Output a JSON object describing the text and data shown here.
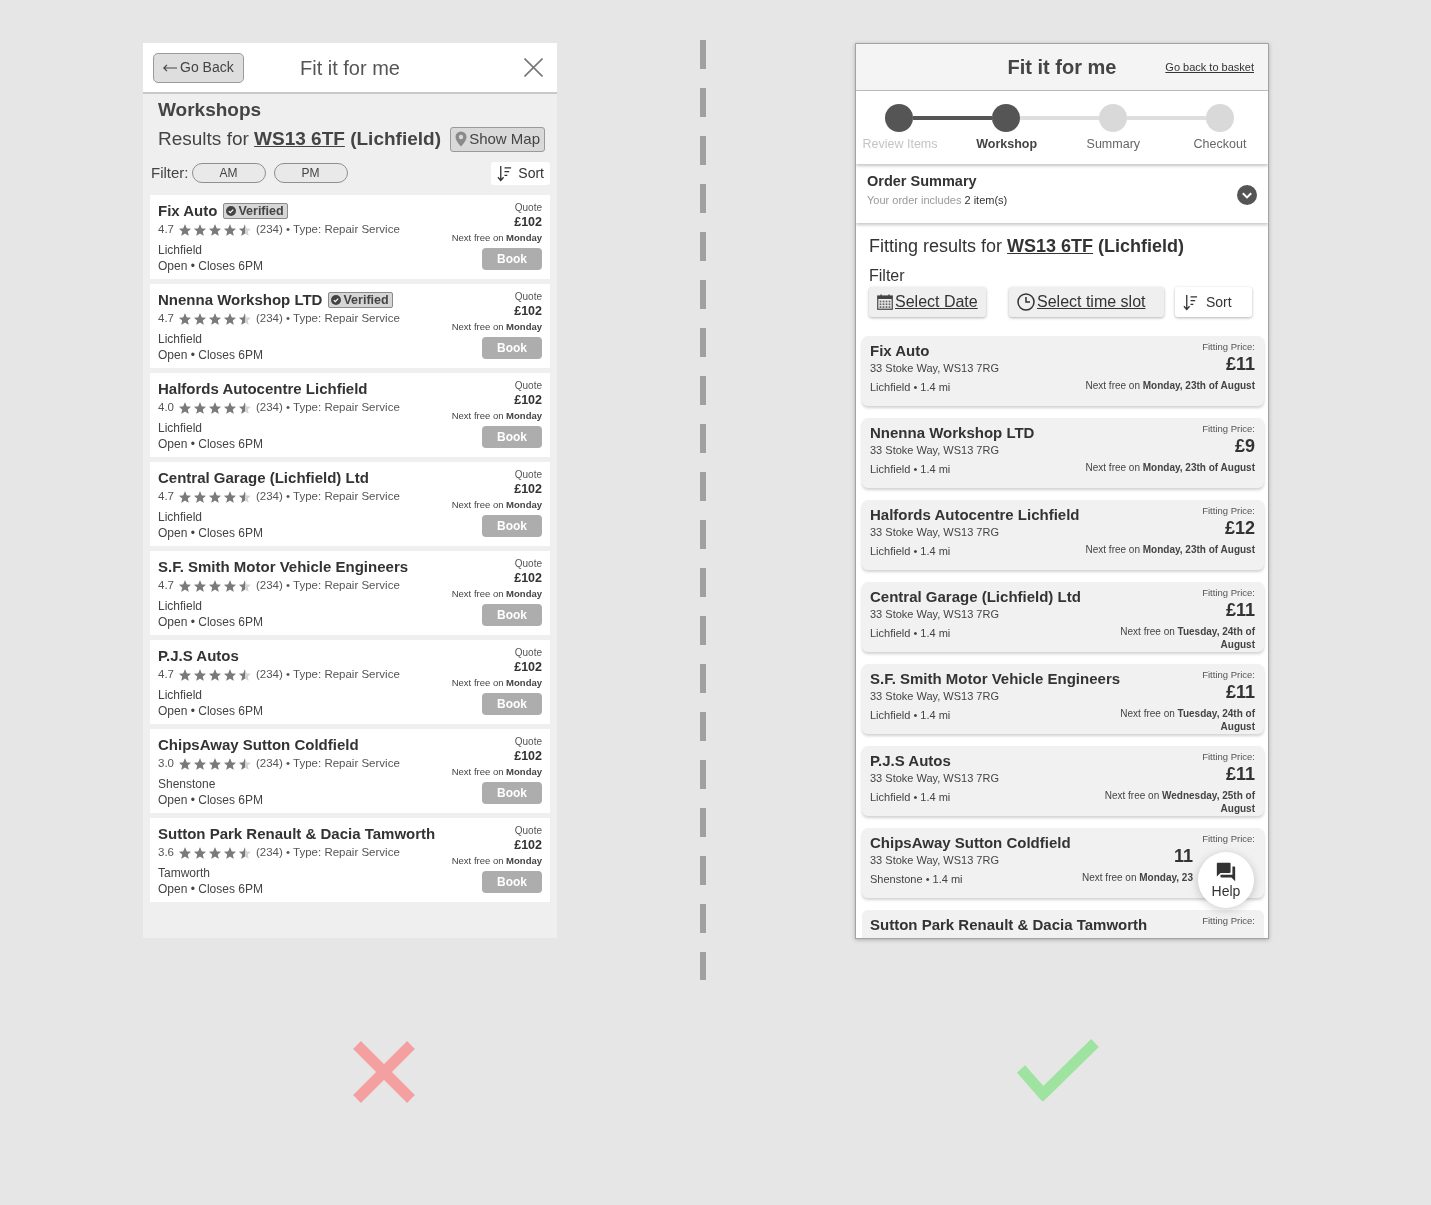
{
  "wrong_mockup": {
    "correct": false,
    "header": {
      "back_button": "Go Back",
      "title": "Fit it for me"
    },
    "heading": "Workshops",
    "results": {
      "prefix": "Results for",
      "postcode": "WS13 6TF",
      "area": "(Lichfield)"
    },
    "show_map_button": "Show Map",
    "filter": {
      "label": "Filter:",
      "options": [
        {
          "label": "AM",
          "selected": false
        },
        {
          "label": "PM",
          "selected": false
        }
      ]
    },
    "sort_button": "Sort",
    "workshops": [
      {
        "name": "Fix Auto",
        "badge": "Verified",
        "rating": "4.7",
        "stars": 4.5,
        "reviews": "(234) • Type: Repair Service",
        "town": "Lichfield",
        "hours": "Open • Closes 6PM",
        "quote_label": "Quote",
        "quote": "£102",
        "next_free": "Next free on **Monday**",
        "book_button": "Book"
      },
      {
        "name": "Nnenna Workshop LTD",
        "badge": "Verified",
        "rating": "4.7",
        "stars": 4.5,
        "reviews": "(234) • Type: Repair Service",
        "town": "Lichfield",
        "hours": "Open • Closes 6PM",
        "quote_label": "Quote",
        "quote": "£102",
        "next_free": "Next free on **Monday**",
        "book_button": "Book"
      },
      {
        "name": "Halfords Autocentre Lichfield",
        "rating": "4.0",
        "stars": 4.5,
        "reviews": "(234) • Type: Repair Service",
        "town": "Lichfield",
        "hours": "Open • Closes 6PM",
        "quote_label": "Quote",
        "quote": "£102",
        "next_free": "Next free on **Monday**",
        "book_button": "Book"
      },
      {
        "name": "Central Garage (Lichfield) Ltd",
        "rating": "4.7",
        "stars": 4.5,
        "reviews": "(234) • Type: Repair Service",
        "town": "Lichfield",
        "hours": "Open • Closes 6PM",
        "quote_label": "Quote",
        "quote": "£102",
        "next_free": "Next free on **Monday**",
        "book_button": "Book"
      },
      {
        "name": "S.F. Smith Motor Vehicle Engineers",
        "rating": "4.7",
        "stars": 4.5,
        "reviews": "(234) • Type: Repair Service",
        "town": "Lichfield",
        "hours": "Open • Closes 6PM",
        "quote_label": "Quote",
        "quote": "£102",
        "next_free": "Next free on **Monday**",
        "book_button": "Book"
      },
      {
        "name": "P.J.S Autos",
        "rating": "4.7",
        "stars": 4.5,
        "reviews": "(234) • Type: Repair Service",
        "town": "Lichfield",
        "hours": "Open • Closes 6PM",
        "quote_label": "Quote",
        "quote": "£102",
        "next_free": "Next free on **Monday**",
        "book_button": "Book"
      },
      {
        "name": "ChipsAway Sutton Coldfield",
        "rating": "3.0",
        "stars": 4.5,
        "reviews": "(234) • Type: Repair Service",
        "town": "Shenstone",
        "hours": "Open • Closes 6PM",
        "quote_label": "Quote",
        "quote": "£102",
        "next_free": "Next free on **Monday**",
        "book_button": "Book"
      },
      {
        "name": "Sutton Park Renault & Dacia Tamworth",
        "rating": "3.6",
        "stars": 4.5,
        "reviews": "(234) • Type: Repair Service",
        "town": "Tamworth",
        "hours": "Open • Closes 6PM",
        "quote_label": "Quote",
        "quote": "£102",
        "next_free": "Next free on **Monday**",
        "book_button": "Book"
      }
    ]
  },
  "right_mockup": {
    "correct": true,
    "header": {
      "title": "Fit it for me",
      "back_link": "Go back to basket"
    },
    "steps": [
      {
        "label": "Review Items",
        "reached": true,
        "selected": false
      },
      {
        "label": "Workshop",
        "reached": true,
        "selected": true
      },
      {
        "label": "Summary",
        "reached": false,
        "selected": false
      },
      {
        "label": "Checkout",
        "reached": false,
        "selected": false
      }
    ],
    "order_summary": {
      "title": "Order Summary",
      "note": "Your order includes",
      "count": "2 item(s)",
      "expanded": false
    },
    "results": {
      "prefix": "Fitting results for",
      "postcode": "WS13 6TF",
      "area": "(Lichfield)"
    },
    "filter": {
      "label": "Filter",
      "buttons": [
        {
          "kind": "date",
          "label": "Select Date"
        },
        {
          "kind": "time",
          "label": "Select time slot"
        }
      ]
    },
    "sort_button": "Sort",
    "workshops": [
      {
        "name": "Fix Auto",
        "address": "33 Stoke Way, WS13 7RG",
        "location": "Lichfield • 1.4 mi",
        "price_label": "Fitting Price:",
        "price": "£11",
        "next_free": "Next free on **Monday, 23th of August**",
        "under_help_button": false
      },
      {
        "name": "Nnenna Workshop LTD",
        "address": "33 Stoke Way, WS13 7RG",
        "location": "Lichfield • 1.4 mi",
        "price_label": "Fitting Price:",
        "price": "£9",
        "next_free": "Next free on **Monday, 23th of August**",
        "under_help_button": false
      },
      {
        "name": "Halfords Autocentre Lichfield",
        "address": "33 Stoke Way, WS13 7RG",
        "location": "Lichfield • 1.4 mi",
        "price_label": "Fitting Price:",
        "price": "£12",
        "next_free": "Next free on **Monday, 23th of August**",
        "under_help_button": false
      },
      {
        "name": "Central Garage (Lichfield) Ltd",
        "address": "33 Stoke Way, WS13 7RG",
        "location": "Lichfield • 1.4 mi",
        "price_label": "Fitting Price:",
        "price": "£11",
        "next_free": "Next free on **Tuesday, 24th of August**",
        "under_help_button": false
      },
      {
        "name": "S.F. Smith Motor Vehicle Engineers",
        "address": "33 Stoke Way, WS13 7RG",
        "location": "Lichfield • 1.4 mi",
        "price_label": "Fitting Price:",
        "price": "£11",
        "next_free": "Next free on **Tuesday, 24th of August**",
        "under_help_button": false
      },
      {
        "name": "P.J.S Autos",
        "address": "33 Stoke Way, WS13 7RG",
        "location": "Lichfield • 1.4 mi",
        "price_label": "Fitting Price:",
        "price": "£11",
        "next_free": "Next free on **Wednesday, 25th of August**",
        "under_help_button": false
      },
      {
        "name": "ChipsAway Sutton Coldfield",
        "address": "33 Stoke Way, WS13 7RG",
        "location": "Shenstone • 1.4 mi",
        "price_label": "Fitting Price:",
        "price": "11",
        "next_free": "Next free on **Monday, 23**",
        "under_help_button": true
      },
      {
        "name": "Sutton Park Renault & Dacia Tamworth",
        "price_label": "Fitting Price:"
      }
    ],
    "help_button": "Help"
  }
}
